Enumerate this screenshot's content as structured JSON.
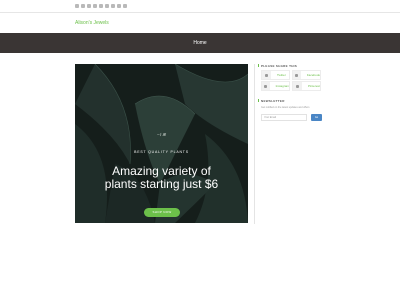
{
  "topbar": {
    "social_icons": [
      "twitter-icon",
      "facebook-icon",
      "pinterest-icon",
      "instagram-icon",
      "tumblr-icon",
      "youtube-icon",
      "linkedin-icon",
      "rss-icon",
      "email-icon"
    ]
  },
  "site": {
    "title": "Alison's Jewels"
  },
  "nav": {
    "items": [
      {
        "label": "Home"
      }
    ]
  },
  "hero": {
    "logo_text": "~⌇ ꕤ",
    "tagline": "BEST QUALITY PLANTS",
    "headline_line1": "Amazing variety of",
    "headline_line2": "plants starting just $6",
    "button_label": "SHOP NOW"
  },
  "sidebar": {
    "share_title": "PLEASE SHARE THIS",
    "share_items": [
      {
        "label": "Twitter",
        "icon": "twitter-icon"
      },
      {
        "label": "Facebook",
        "icon": "facebook-icon"
      },
      {
        "label": "Instagram",
        "icon": "instagram-icon"
      },
      {
        "label": "Pinterest",
        "icon": "pinterest-icon"
      }
    ],
    "newsletter_title": "NEWSLETTER",
    "newsletter_desc": "Get notified on the latest updates and offers",
    "email_placeholder": "Your Email",
    "subscribe_label": "Go"
  },
  "colors": {
    "accent": "#6cc04a",
    "navbar": "#3a3534",
    "button_blue": "#4a86c5"
  }
}
